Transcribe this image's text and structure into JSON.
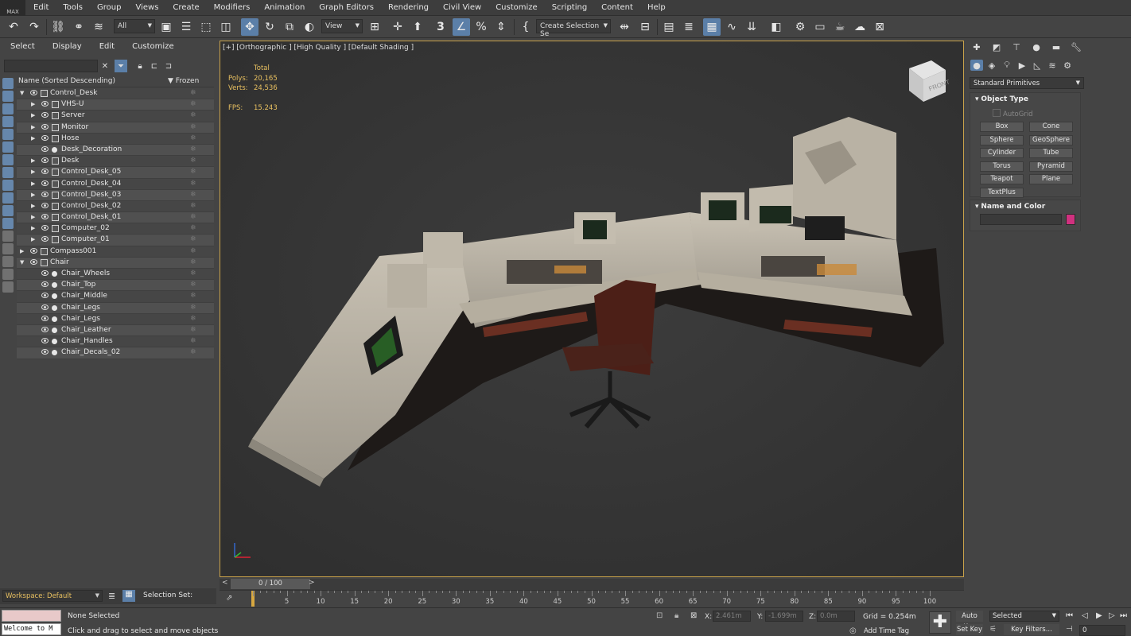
{
  "app": {
    "logo_text": "MAX"
  },
  "menubar": {
    "items": [
      "Edit",
      "Tools",
      "Group",
      "Views",
      "Create",
      "Modifiers",
      "Animation",
      "Graph Editors",
      "Rendering",
      "Civil View",
      "Customize",
      "Scripting",
      "Content",
      "Help"
    ]
  },
  "toolbar": {
    "selection_filter": "All",
    "ref_coord": "View",
    "named_selection": "Create Selection Se",
    "snap_label": "3",
    "icons": [
      "undo-icon",
      "redo-icon",
      "link-icon",
      "unlink-icon",
      "bind-spacewarp-icon",
      "select-object-icon",
      "select-by-name-icon",
      "rect-region-icon",
      "window-crossing-icon",
      "move-icon",
      "rotate-icon",
      "scale-icon",
      "place-icon",
      "select-manipulate-icon",
      "keyboard-shortcut-icon",
      "snaps-toggle-icon",
      "angle-snap-icon",
      "percent-snap-icon",
      "spinner-snap-icon",
      "edit-named-sets-icon",
      "mirror-icon",
      "align-icon",
      "scene-explorer-icon",
      "layer-explorer-icon",
      "ribbon-icon",
      "curve-editor-icon",
      "schematic-icon",
      "material-editor-icon",
      "render-setup-icon",
      "render-frame-icon",
      "render-icon",
      "render-cloud-icon",
      "a360-icon"
    ]
  },
  "explorer": {
    "tabs": [
      "Select",
      "Display",
      "Edit",
      "Customize"
    ],
    "col_name": "Name (Sorted Descending)",
    "col_frozen": "Frozen",
    "items": [
      {
        "name": "Control_Desk",
        "depth": 0,
        "expanded": true
      },
      {
        "name": "VHS-U",
        "depth": 1,
        "expandable": true
      },
      {
        "name": "Server",
        "depth": 1,
        "expandable": true
      },
      {
        "name": "Monitor",
        "depth": 1,
        "expandable": true
      },
      {
        "name": "Hose",
        "depth": 1,
        "expandable": true
      },
      {
        "name": "Desk_Decoration",
        "depth": 1,
        "expandable": false
      },
      {
        "name": "Desk",
        "depth": 1,
        "expandable": true
      },
      {
        "name": "Control_Desk_05",
        "depth": 1,
        "expandable": true
      },
      {
        "name": "Control_Desk_04",
        "depth": 1,
        "expandable": true
      },
      {
        "name": "Control_Desk_03",
        "depth": 1,
        "expandable": true
      },
      {
        "name": "Control_Desk_02",
        "depth": 1,
        "expandable": true
      },
      {
        "name": "Control_Desk_01",
        "depth": 1,
        "expandable": true
      },
      {
        "name": "Computer_02",
        "depth": 1,
        "expandable": true
      },
      {
        "name": "Computer_01",
        "depth": 1,
        "expandable": true
      },
      {
        "name": "Compass001",
        "depth": 0,
        "expandable": true
      },
      {
        "name": "Chair",
        "depth": 0,
        "expanded": true
      },
      {
        "name": "Chair_Wheels",
        "depth": 1,
        "expandable": false
      },
      {
        "name": "Chair_Top",
        "depth": 1,
        "expandable": false
      },
      {
        "name": "Chair_Middle",
        "depth": 1,
        "expandable": false
      },
      {
        "name": "Chair_Legs",
        "depth": 1,
        "expandable": false
      },
      {
        "name": "Chair_Legs",
        "depth": 1,
        "expandable": false
      },
      {
        "name": "Chair_Leather",
        "depth": 1,
        "expandable": false
      },
      {
        "name": "Chair_Handles",
        "depth": 1,
        "expandable": false
      },
      {
        "name": "Chair_Decals_02",
        "depth": 1,
        "expandable": false
      }
    ]
  },
  "viewport": {
    "label": "[+] [Orthographic ] [High Quality ] [Default Shading ]",
    "stats": {
      "total_label": "Total",
      "polys_label": "Polys:",
      "polys": "20,165",
      "verts_label": "Verts:",
      "verts": "24,536",
      "fps_label": "FPS:",
      "fps": "15.243"
    },
    "viewcube_label": "FRONT"
  },
  "command_panel": {
    "category": "Standard Primitives",
    "object_type_title": "Object Type",
    "autogrid": "AutoGrid",
    "buttons": [
      "Box",
      "Cone",
      "Sphere",
      "GeoSphere",
      "Cylinder",
      "Tube",
      "Torus",
      "Pyramid",
      "Teapot",
      "Plane",
      "TextPlus"
    ],
    "name_color_title": "Name and Color",
    "object_color": "#d0317f"
  },
  "timeline": {
    "slider": "0 / 100",
    "prev": "<",
    "next": ">",
    "ticks": [
      "5",
      "10",
      "15",
      "20",
      "25",
      "30",
      "35",
      "40",
      "45",
      "50",
      "55",
      "60",
      "65",
      "70",
      "75",
      "80",
      "85",
      "90",
      "95",
      "100"
    ]
  },
  "workspace": {
    "label": "Workspace: Default",
    "selection_set_label": "Selection Set:"
  },
  "status": {
    "maxscript": "Welcome to M",
    "selection": "None Selected",
    "prompt": "Click and drag to select and move objects",
    "x_label": "X:",
    "x": "2.461m",
    "y_label": "Y:",
    "y": "-1.699m",
    "z_label": "Z:",
    "z": "0.0m",
    "grid": "Grid = 0.254m",
    "add_time_tag": "Add Time Tag",
    "auto_key": "Auto Key",
    "set_key": "Set Key",
    "key_mode": "Selected",
    "key_filters": "Key Filters...",
    "frame": "0"
  }
}
